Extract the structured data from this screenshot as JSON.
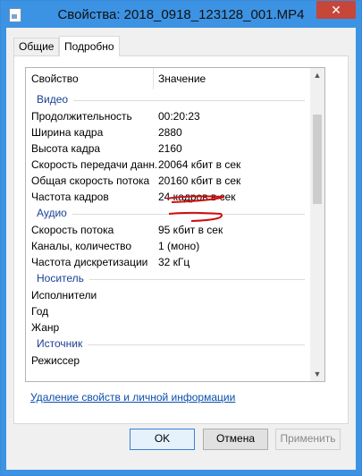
{
  "window": {
    "title": "Свойства: 2018_0918_123128_001.MP4",
    "close_glyph": "✕"
  },
  "tabs": [
    {
      "label": "Общие",
      "active": false
    },
    {
      "label": "Подробно",
      "active": true
    }
  ],
  "list": {
    "columns": [
      "Свойство",
      "Значение"
    ],
    "groups": [
      {
        "name": "Видео",
        "rows": [
          {
            "name": "Продолжительность",
            "value": "00:20:23"
          },
          {
            "name": "Ширина кадра",
            "value": "2880"
          },
          {
            "name": "Высота кадра",
            "value": "2160"
          },
          {
            "name": "Скорость передачи данн...",
            "value": "20064 кбит в сек"
          },
          {
            "name": "Общая скорость потока",
            "value": "20160 кбит в сек"
          },
          {
            "name": "Частота кадров",
            "value": "24 кадров в сек"
          }
        ]
      },
      {
        "name": "Аудио",
        "rows": [
          {
            "name": "Скорость потока",
            "value": "95 кбит в сек"
          },
          {
            "name": "Каналы, количество",
            "value": "1 (моно)"
          },
          {
            "name": "Частота дискретизации",
            "value": "32 кГц"
          }
        ]
      },
      {
        "name": "Носитель",
        "rows": [
          {
            "name": "Исполнители",
            "value": ""
          },
          {
            "name": "Год",
            "value": ""
          },
          {
            "name": "Жанр",
            "value": ""
          }
        ]
      },
      {
        "name": "Источник",
        "rows": [
          {
            "name": "Режиссер",
            "value": ""
          }
        ]
      }
    ]
  },
  "link": "Удаление свойств и личной информации",
  "buttons": {
    "ok": "OK",
    "cancel": "Отмена",
    "apply": "Применить"
  },
  "colors": {
    "titlebar": "#3c93e3",
    "group_text": "#1a3f95",
    "annotation": "#d01010"
  }
}
